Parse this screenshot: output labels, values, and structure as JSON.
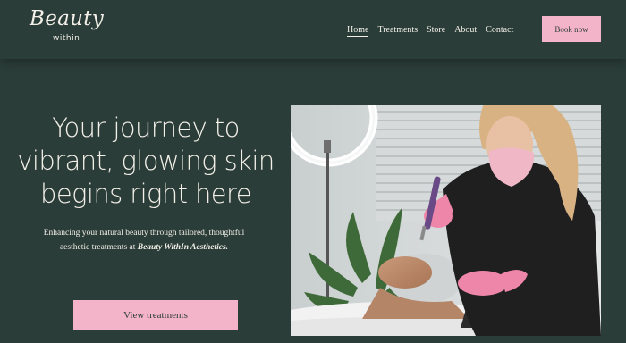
{
  "logo": {
    "script": "Beauty",
    "sub": "within"
  },
  "nav": {
    "items": [
      {
        "label": "Home",
        "active": true
      },
      {
        "label": "Treatments",
        "active": false
      },
      {
        "label": "Store",
        "active": false
      },
      {
        "label": "About",
        "active": false
      },
      {
        "label": "Contact",
        "active": false
      }
    ],
    "book_label": "Book now"
  },
  "hero": {
    "title_lines": [
      "Your journey to",
      "vibrant, glowing skin",
      "begins right here"
    ],
    "subtitle_line1": "Enhancing your natural beauty through tailored, thoughtful",
    "subtitle_line2_prefix": "aesthetic treatments at ",
    "subtitle_brand": "Beauty WithIn Aesthetics.",
    "cta_label": "View treatments"
  },
  "colors": {
    "background": "#2b3d38",
    "accent": "#f3b3c8",
    "text": "#f3efe9"
  },
  "photo": {
    "icon": "treatment-photo"
  }
}
